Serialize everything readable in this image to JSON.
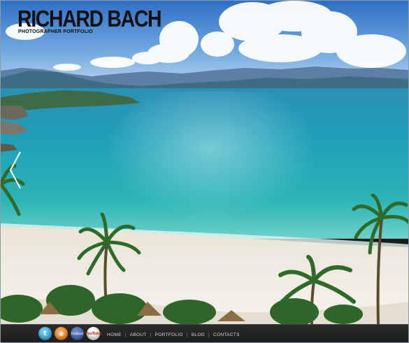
{
  "site": {
    "title": "RICHARD BACH",
    "subtitle": "PHOTOGRAPHER PORTFOLIO"
  },
  "slider": {
    "prev_icon": "chevron-left-icon"
  },
  "social": [
    {
      "name": "twitter",
      "glyph": "t",
      "icon": "twitter-icon"
    },
    {
      "name": "rss",
      "glyph": "◉",
      "icon": "rss-icon"
    },
    {
      "name": "facebook",
      "glyph": "facebook",
      "icon": "facebook-icon"
    },
    {
      "name": "youtube",
      "glyph": "YouTube",
      "icon": "youtube-icon"
    }
  ],
  "nav": {
    "home": "HOME",
    "about": "ABOUT",
    "portfolio": "PORTFOLIO",
    "blog": "BLOG",
    "contacts": "CONTACTS",
    "separator": "|"
  },
  "colors": {
    "sky_top": "#3f7fd0",
    "sea": "#1e9bb0",
    "sand": "#efece4",
    "footer": "#222222"
  }
}
